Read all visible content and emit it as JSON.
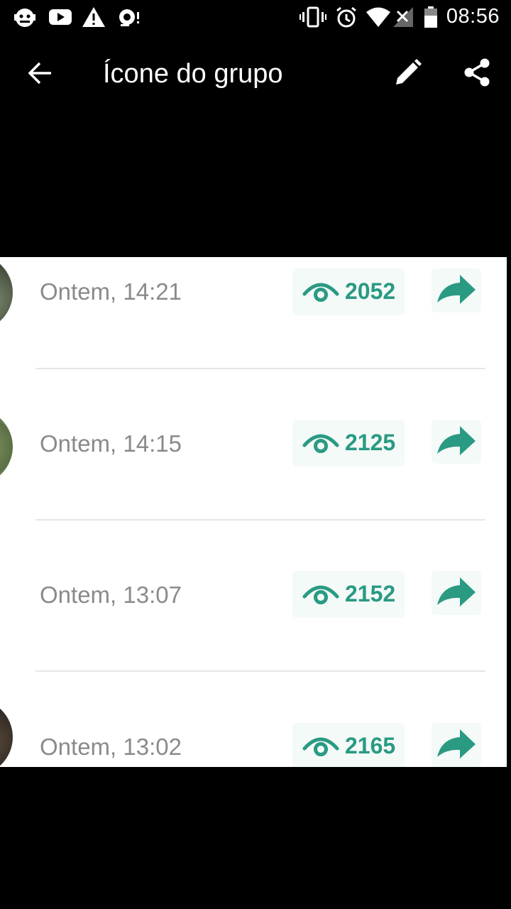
{
  "status_bar": {
    "time": "08:56",
    "icons": [
      "android-debug-icon",
      "youtube-icon",
      "warning-icon",
      "headset-icon",
      "vibrate-icon",
      "alarm-icon",
      "wifi-icon",
      "signal-icon",
      "battery-icon"
    ]
  },
  "app_bar": {
    "title": "Ícone do grupo",
    "back_icon": "arrow-left-icon",
    "edit_icon": "pencil-icon",
    "share_icon": "share-icon"
  },
  "messages": [
    {
      "time": "Ontem, 14:21",
      "views": "2052"
    },
    {
      "time": "Ontem, 14:15",
      "views": "2125"
    },
    {
      "time": "Ontem, 13:07",
      "views": "2152"
    },
    {
      "time": "Ontem, 13:02",
      "views": "2165"
    }
  ],
  "colors": {
    "accent": "#2a9a83",
    "background": "#000000",
    "photo_background": "#ffffff",
    "time_text": "#8a8a8a"
  }
}
